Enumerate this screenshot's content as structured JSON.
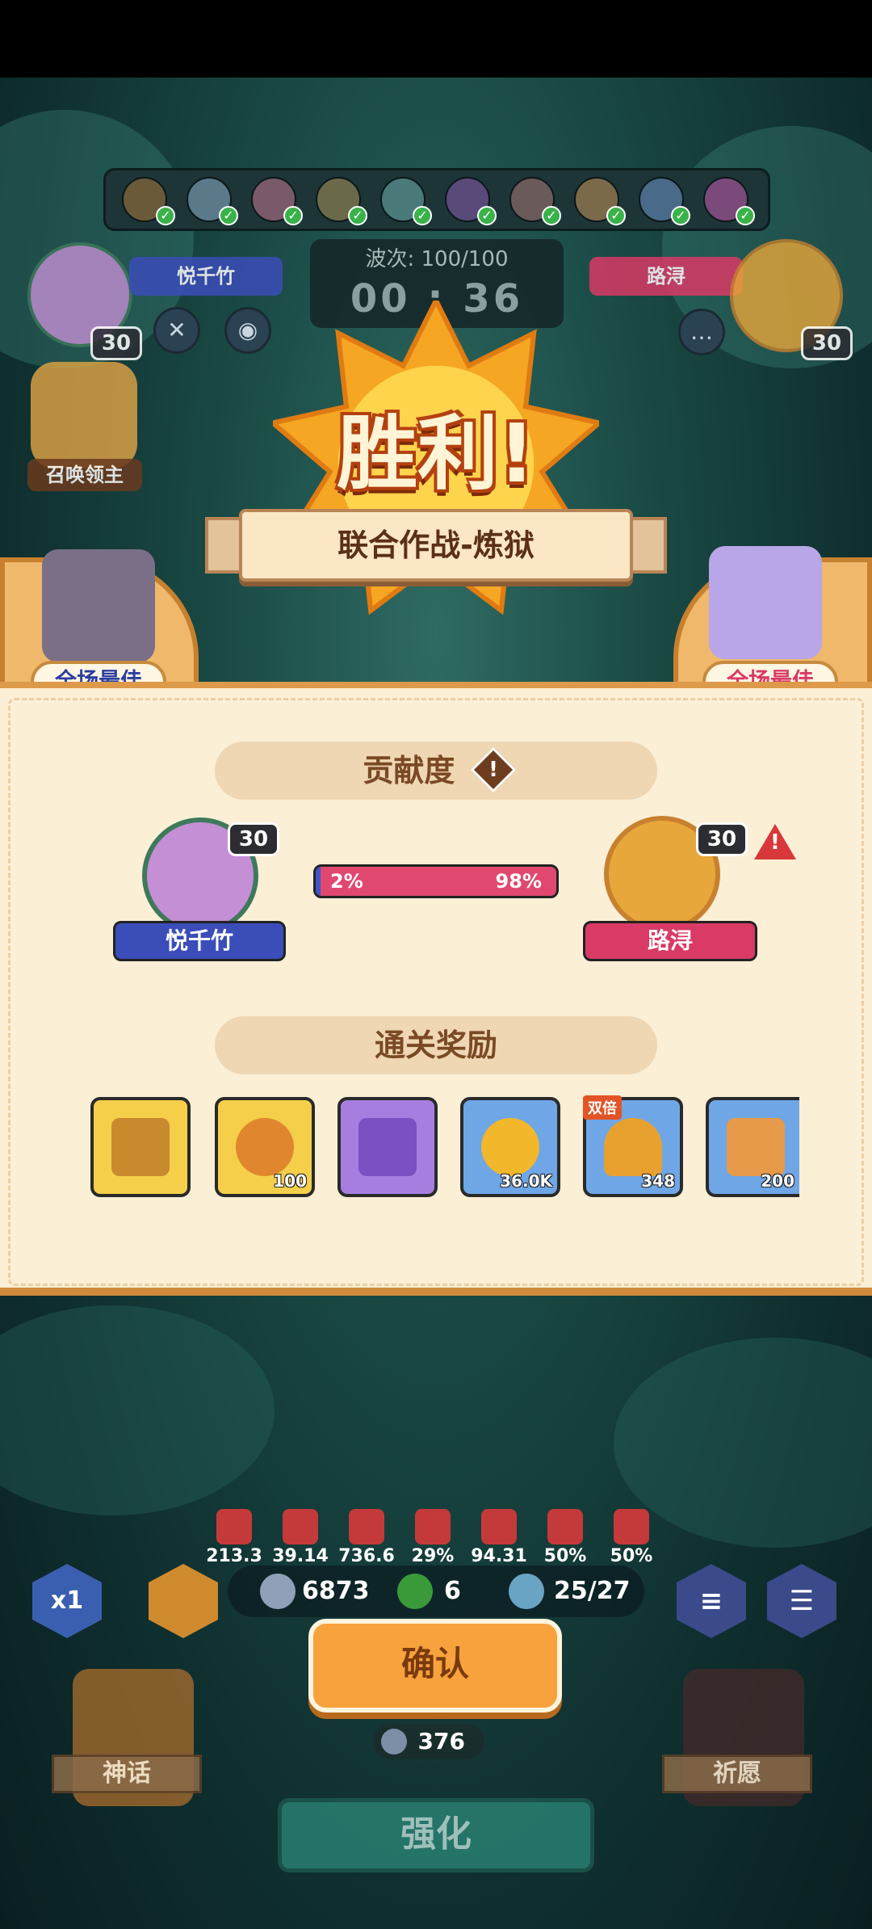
{
  "battle": {
    "wave_text": "波次: 100/100",
    "timer": "00 : 36"
  },
  "players": {
    "left": {
      "name": "悦千竹",
      "level": "30",
      "color": "#3b4db8"
    },
    "right": {
      "name": "路浔",
      "level": "30",
      "color": "#d93a66"
    }
  },
  "summon_lord": {
    "label": "召唤领主"
  },
  "result": {
    "title": "胜利!",
    "mode": "联合作战-炼狱",
    "mvp_label": "全场最佳"
  },
  "contribution": {
    "heading": "贡献度",
    "warn_icon": "!",
    "left_percent_text": "2%",
    "right_percent_text": "98%",
    "left_fraction": 0.02
  },
  "rewards": {
    "heading": "通关奖励",
    "double_label": "双倍",
    "items": [
      {
        "icon": "gold-chest-icon",
        "qty": "",
        "bg": "#f5cf4a"
      },
      {
        "icon": "key-icon",
        "qty": "100",
        "bg": "#f5cf4a"
      },
      {
        "icon": "purple-chest-icon",
        "qty": "",
        "bg": "#a77ee0"
      },
      {
        "icon": "gold-coin-icon",
        "qty": "36.0K",
        "bg": "#6fa6e6"
      },
      {
        "icon": "trophy-icon",
        "qty": "348",
        "bg": "#6fa6e6"
      },
      {
        "icon": "cookie-icon",
        "qty": "200",
        "bg": "#6fa6e6"
      }
    ]
  },
  "stats": [
    "213.3",
    "39.14",
    "736.6",
    "29%",
    "94.31",
    "50%",
    "50%"
  ],
  "resources": {
    "silver": "6873",
    "clover": "6",
    "units": "25/27"
  },
  "hud": {
    "speed": "x1",
    "confirm": "确认",
    "cost": "376",
    "myth": "神话",
    "pray": "祈愿",
    "strengthen": "强化"
  }
}
